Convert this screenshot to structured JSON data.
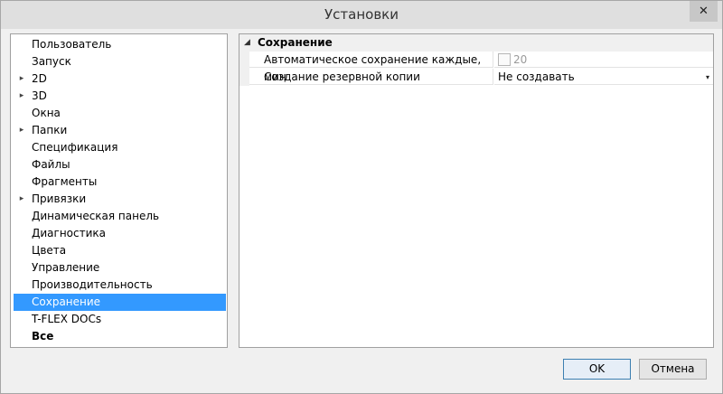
{
  "window": {
    "title": "Установки",
    "close_icon": "close-icon"
  },
  "tree": {
    "items": [
      {
        "label": "Пользователь",
        "arrow": ""
      },
      {
        "label": "Запуск",
        "arrow": ""
      },
      {
        "label": "2D",
        "arrow": "▸"
      },
      {
        "label": "3D",
        "arrow": "▸"
      },
      {
        "label": "Окна",
        "arrow": ""
      },
      {
        "label": "Папки",
        "arrow": "▸"
      },
      {
        "label": "Спецификация",
        "arrow": ""
      },
      {
        "label": "Файлы",
        "arrow": ""
      },
      {
        "label": "Фрагменты",
        "arrow": ""
      },
      {
        "label": "Привязки",
        "arrow": "▸"
      },
      {
        "label": "Динамическая панель",
        "arrow": ""
      },
      {
        "label": "Диагностика",
        "arrow": ""
      },
      {
        "label": "Цвета",
        "arrow": ""
      },
      {
        "label": "Управление",
        "arrow": ""
      },
      {
        "label": "Производительность",
        "arrow": ""
      },
      {
        "label": "Сохранение",
        "arrow": ""
      },
      {
        "label": "T-FLEX DOCs",
        "arrow": ""
      },
      {
        "label": "Все",
        "arrow": ""
      }
    ],
    "selected": "Сохранение",
    "selection_color": "#3399ff"
  },
  "grid": {
    "section": {
      "label": "Сохранение",
      "arrow": "◢"
    },
    "rows": [
      {
        "name": "Автоматическое сохранение каждые, мин",
        "value": "20"
      },
      {
        "name": "Создание резервной копии",
        "value": "Не создавать",
        "dropdown": "▾"
      }
    ]
  },
  "buttons": {
    "ok": "OK",
    "cancel": "Отмена"
  }
}
